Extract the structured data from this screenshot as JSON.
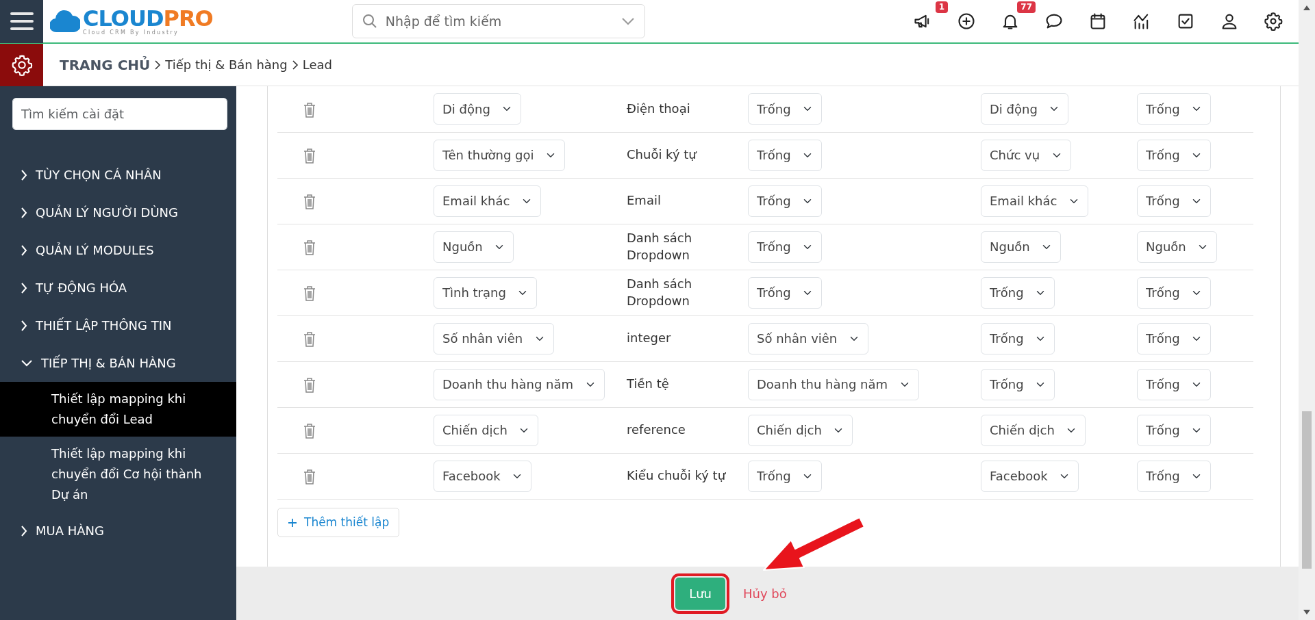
{
  "header": {
    "logo": {
      "name_part_1": "CLOUD",
      "name_part_2": "PRO",
      "tagline": "Cloud CRM By Industry"
    },
    "search": {
      "placeholder": "Nhập để tìm kiếm"
    },
    "icons": [
      {
        "kind": "megaphone",
        "badge": "1"
      },
      {
        "kind": "plus"
      },
      {
        "kind": "bell",
        "badge": "77"
      },
      {
        "kind": "chat"
      },
      {
        "kind": "calendar"
      },
      {
        "kind": "chart"
      },
      {
        "kind": "task"
      },
      {
        "kind": "user"
      },
      {
        "kind": "settings"
      }
    ]
  },
  "breadcrumb": [
    "TRANG CHỦ",
    "Tiếp thị & Bán hàng",
    "Lead"
  ],
  "sidebar": {
    "search": {
      "placeholder": "Tìm kiếm cài đặt"
    },
    "items": [
      {
        "label": "TÙY CHỌN CÁ NHÂN",
        "expanded": false
      },
      {
        "label": "QUẢN LÝ NGƯỜI DÙNG",
        "expanded": false
      },
      {
        "label": "QUẢN LÝ MODULES",
        "expanded": false
      },
      {
        "label": "TỰ ĐỘNG HÓA",
        "expanded": false
      },
      {
        "label": "THIẾT LẬP THÔNG TIN",
        "expanded": false
      },
      {
        "label": "TIẾP THỊ & BÁN HÀNG",
        "expanded": true,
        "children": [
          {
            "label": "Thiết lập mapping khi chuyển đổi Lead",
            "selected": true
          },
          {
            "label": "Thiết lập mapping khi chuyển đổi Cơ hội thành Dự án",
            "selected": false
          }
        ]
      },
      {
        "label": "MUA HÀNG",
        "expanded": false
      }
    ]
  },
  "table": {
    "rows": [
      {
        "column_2": "Di động",
        "column_3": "Điện thoại",
        "column_4": "Trống",
        "column_5": "Di động",
        "column_6": "Trống"
      },
      {
        "column_2": "Tên thường gọi",
        "column_3": "Chuỗi ký tự",
        "column_4": "Trống",
        "column_5": "Chức vụ",
        "column_6": "Trống"
      },
      {
        "column_2": "Email khác",
        "column_3": "Email",
        "column_4": "Trống",
        "column_5": "Email khác",
        "column_6": "Trống"
      },
      {
        "column_2": "Nguồn",
        "column_3": "Danh sách Dropdown",
        "column_4": "Trống",
        "column_5": "Nguồn",
        "column_6": "Nguồn"
      },
      {
        "column_2": "Tình trạng",
        "column_3": "Danh sách Dropdown",
        "column_4": "Trống",
        "column_5": "Trống",
        "column_6": "Trống"
      },
      {
        "column_2": "Số nhân viên",
        "column_3": "integer",
        "column_4": "Số nhân viên",
        "column_5": "Trống",
        "column_6": "Trống"
      },
      {
        "column_2": "Doanh thu hàng năm",
        "column_3": "Tiền tệ",
        "column_4": "Doanh thu hàng năm",
        "column_5": "Trống",
        "column_6": "Trống"
      },
      {
        "column_2": "Chiến dịch",
        "column_3": "reference",
        "column_4": "Chiến dịch",
        "column_5": "Chiến dịch",
        "column_6": "Trống"
      },
      {
        "column_2": "Facebook",
        "column_3": "Kiểu chuỗi ký tự",
        "column_4": "Trống",
        "column_5": "Facebook",
        "column_6": "Trống"
      }
    ]
  },
  "add_button": "Thêm thiết lập",
  "footer": {
    "save": {
      "label": "Lưu",
      "highlighted": true
    },
    "cancel": "Hủy bỏ"
  }
}
